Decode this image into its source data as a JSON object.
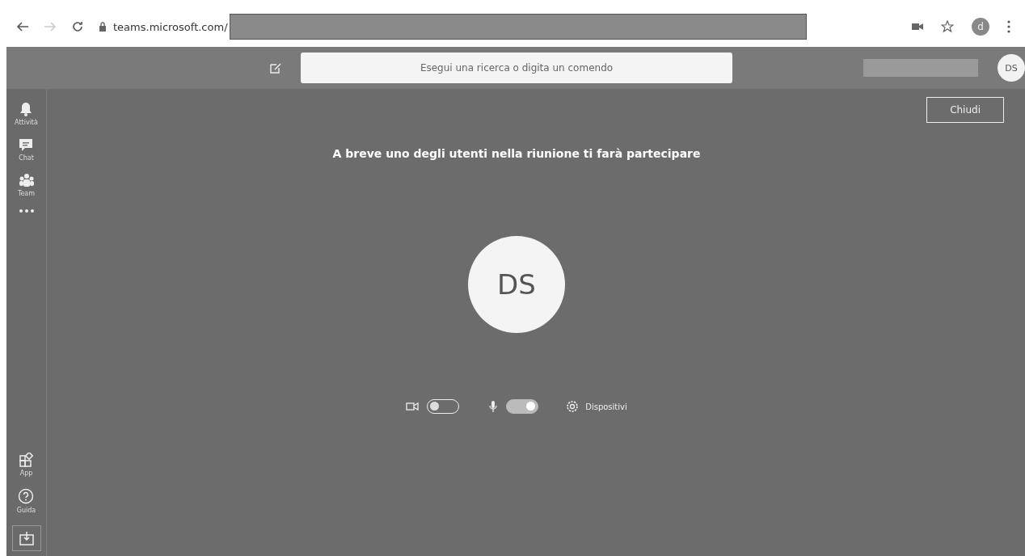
{
  "browser": {
    "url": "teams.microsoft.com/",
    "profile_initial": "d"
  },
  "top_bar": {
    "search": {
      "placeholder": "Esegui una ricerca o digita un comendo"
    },
    "user_initials": "DS"
  },
  "sidebar": {
    "items": [
      {
        "kind": "bell",
        "label": "Attività"
      },
      {
        "kind": "chat",
        "label": "Chat"
      },
      {
        "kind": "team",
        "label": "Team"
      },
      {
        "kind": "more"
      }
    ],
    "bottom_items": [
      {
        "kind": "apps",
        "label": "App"
      },
      {
        "kind": "help",
        "label": "Guida"
      },
      {
        "kind": "download"
      }
    ]
  },
  "close_button": "Chiudi",
  "message": "A breve uno degli utenti nella riunione ti farà partecipare",
  "avatar_initials": "DS",
  "controls": {
    "camera_on": false,
    "mic_on": true,
    "devices_label": "Dispositivi"
  }
}
